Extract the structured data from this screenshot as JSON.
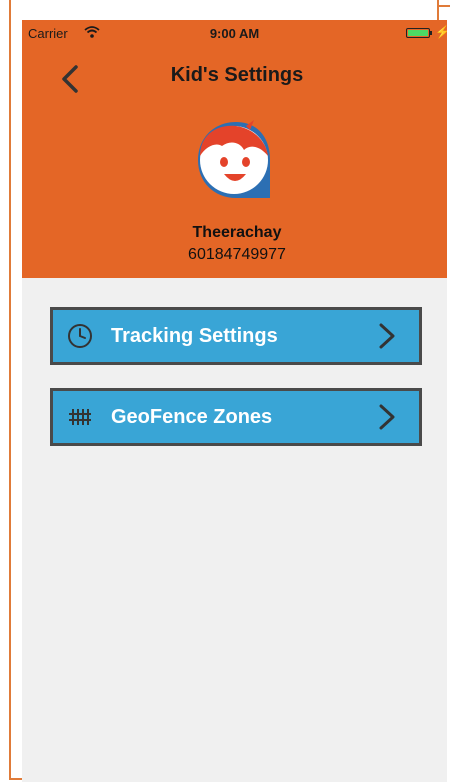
{
  "status_bar": {
    "carrier": "Carrier",
    "time": "9:00 AM",
    "battery_color": "#4cd964"
  },
  "header": {
    "title": "Kid's Settings",
    "background": "#e46626"
  },
  "kid": {
    "name": "Theerachay",
    "phone": "60184749977"
  },
  "menu": [
    {
      "label": "Tracking Settings",
      "icon": "clock-icon"
    },
    {
      "label": "GeoFence Zones",
      "icon": "fence-icon"
    }
  ],
  "colors": {
    "accent": "#e46626",
    "button": "#39a5d6",
    "button_border": "#4a4a4a",
    "background": "#f0f0f0"
  }
}
